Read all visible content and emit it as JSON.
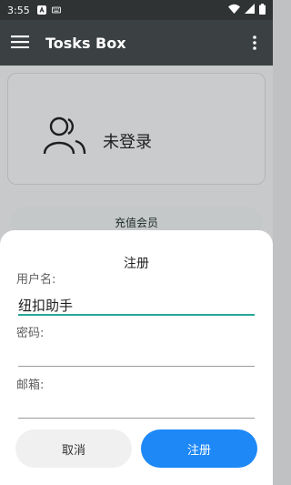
{
  "status_bar": {
    "time": "3:55"
  },
  "app_bar": {
    "title": "Tosks Box"
  },
  "profile_card": {
    "status": "未登录"
  },
  "recharge": {
    "label": "充值会员"
  },
  "dialog": {
    "title": "注册",
    "username": {
      "label": "用户名:",
      "value": "纽扣助手"
    },
    "password": {
      "label": "密码:",
      "value": ""
    },
    "email": {
      "label": "邮箱:",
      "value": ""
    },
    "cancel_label": "取消",
    "register_label": "注册"
  },
  "colors": {
    "accent_underline": "#26a69a",
    "primary_button": "#1e88f7",
    "secondary_button": "#f0f0f0"
  }
}
